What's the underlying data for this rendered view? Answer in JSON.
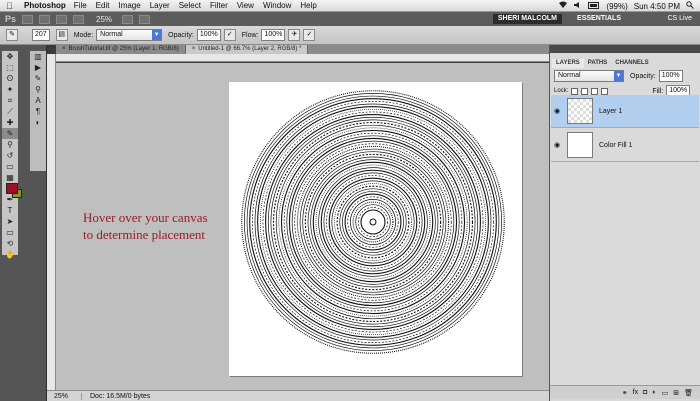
{
  "menubar": {
    "app_name": "Photoshop",
    "items": [
      "File",
      "Edit",
      "Image",
      "Layer",
      "Select",
      "Filter",
      "View",
      "Window",
      "Help"
    ],
    "battery": "(99%)",
    "clock": "Sun 4:50 PM"
  },
  "appbar": {
    "logo": "Ps",
    "zoom": "25%",
    "user": "SHERI MALCOLM",
    "workspace": "ESSENTIALS",
    "cs_live": "CS Live"
  },
  "options": {
    "brush_size": "207",
    "mode_label": "Mode:",
    "mode_value": "Normal",
    "opacity_label": "Opacity:",
    "opacity_value": "100%",
    "flow_label": "Flow:",
    "flow_value": "100%"
  },
  "tabs": [
    {
      "label": "BrushTutorial.tif @ 25% (Layer 1, RGB/8)",
      "active": false
    },
    {
      "label": "Untitled-1 @ 66.7% (Layer 2, RGB/8) *",
      "active": true
    }
  ],
  "canvas": {
    "annotation_line1": "Hover over your canvas",
    "annotation_line2": "to determine placement"
  },
  "status": {
    "zoom": "25%",
    "doc": "Doc: 16.5M/0 bytes"
  },
  "layers_panel": {
    "tabs": [
      "LAYERS",
      "PATHS",
      "CHANNELS"
    ],
    "blend_mode": "Normal",
    "opacity_label": "Opacity:",
    "opacity_value": "100%",
    "lock_label": "Lock:",
    "fill_label": "Fill:",
    "fill_value": "100%",
    "layers": [
      {
        "name": "Layer 1",
        "selected": true
      },
      {
        "name": "Color Fill 1",
        "selected": false
      }
    ]
  },
  "colors": {
    "foreground": "#a10f22",
    "background": "#7c9c2a",
    "annotation": "#a0182c"
  }
}
